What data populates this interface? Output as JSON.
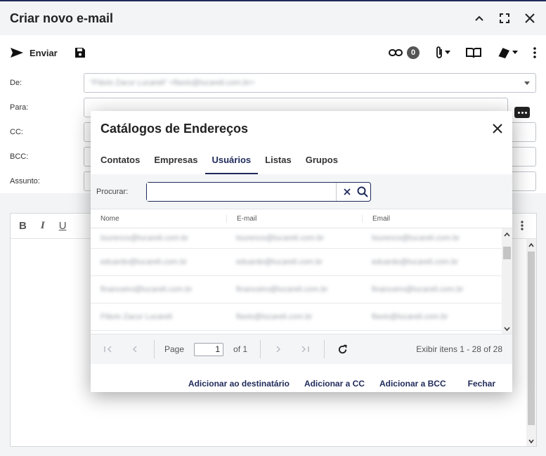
{
  "window": {
    "title": "Criar novo e-mail"
  },
  "toolbar": {
    "send_label": "Enviar",
    "link_count": "0"
  },
  "fields": {
    "from": {
      "label": "De:",
      "value": "\"Flávio Zacur Lucareli\" <flavio@lucareli.com.br>"
    },
    "to": {
      "label": "Para:"
    },
    "cc": {
      "label": "CC:"
    },
    "bcc": {
      "label": "BCC:"
    },
    "subject": {
      "label": "Assunto:"
    }
  },
  "editor": {
    "bold": "B",
    "italic": "I",
    "underline": "U"
  },
  "modal": {
    "title": "Catálogos de Endereços",
    "tabs": [
      {
        "label": "Contatos",
        "active": false
      },
      {
        "label": "Empresas",
        "active": false
      },
      {
        "label": "Usuários",
        "active": true
      },
      {
        "label": "Listas",
        "active": false
      },
      {
        "label": "Grupos",
        "active": false
      }
    ],
    "search": {
      "label": "Procurar:",
      "value": ""
    },
    "columns": [
      "Nome",
      "E-mail",
      "Email"
    ],
    "rows": [
      [
        "lourenco@lucareli.com.br",
        "lourenco@lucareli.com.br",
        "lourenco@lucareli.com.br"
      ],
      [
        "eduardo@lucareli.com.br",
        "eduardo@lucareli.com.br",
        "eduardo@lucareli.com.br"
      ],
      [
        "financeiro@lucareli.com.br",
        "financeiro@lucareli.com.br",
        "financeiro@lucareli.com.br"
      ],
      [
        "Flávio Zacur Lucareli",
        "flavio@lucareli.com.br",
        "flavio@lucareli.com.br"
      ]
    ],
    "pager": {
      "page_label": "Page",
      "page_value": "1",
      "of_label": "of 1",
      "info": "Exibir itens 1 - 28 of 28"
    },
    "actions": {
      "add_to": "Adicionar ao destinatário",
      "add_cc": "Adicionar a CC",
      "add_bcc": "Adicionar a BCC",
      "close": "Fechar"
    }
  }
}
